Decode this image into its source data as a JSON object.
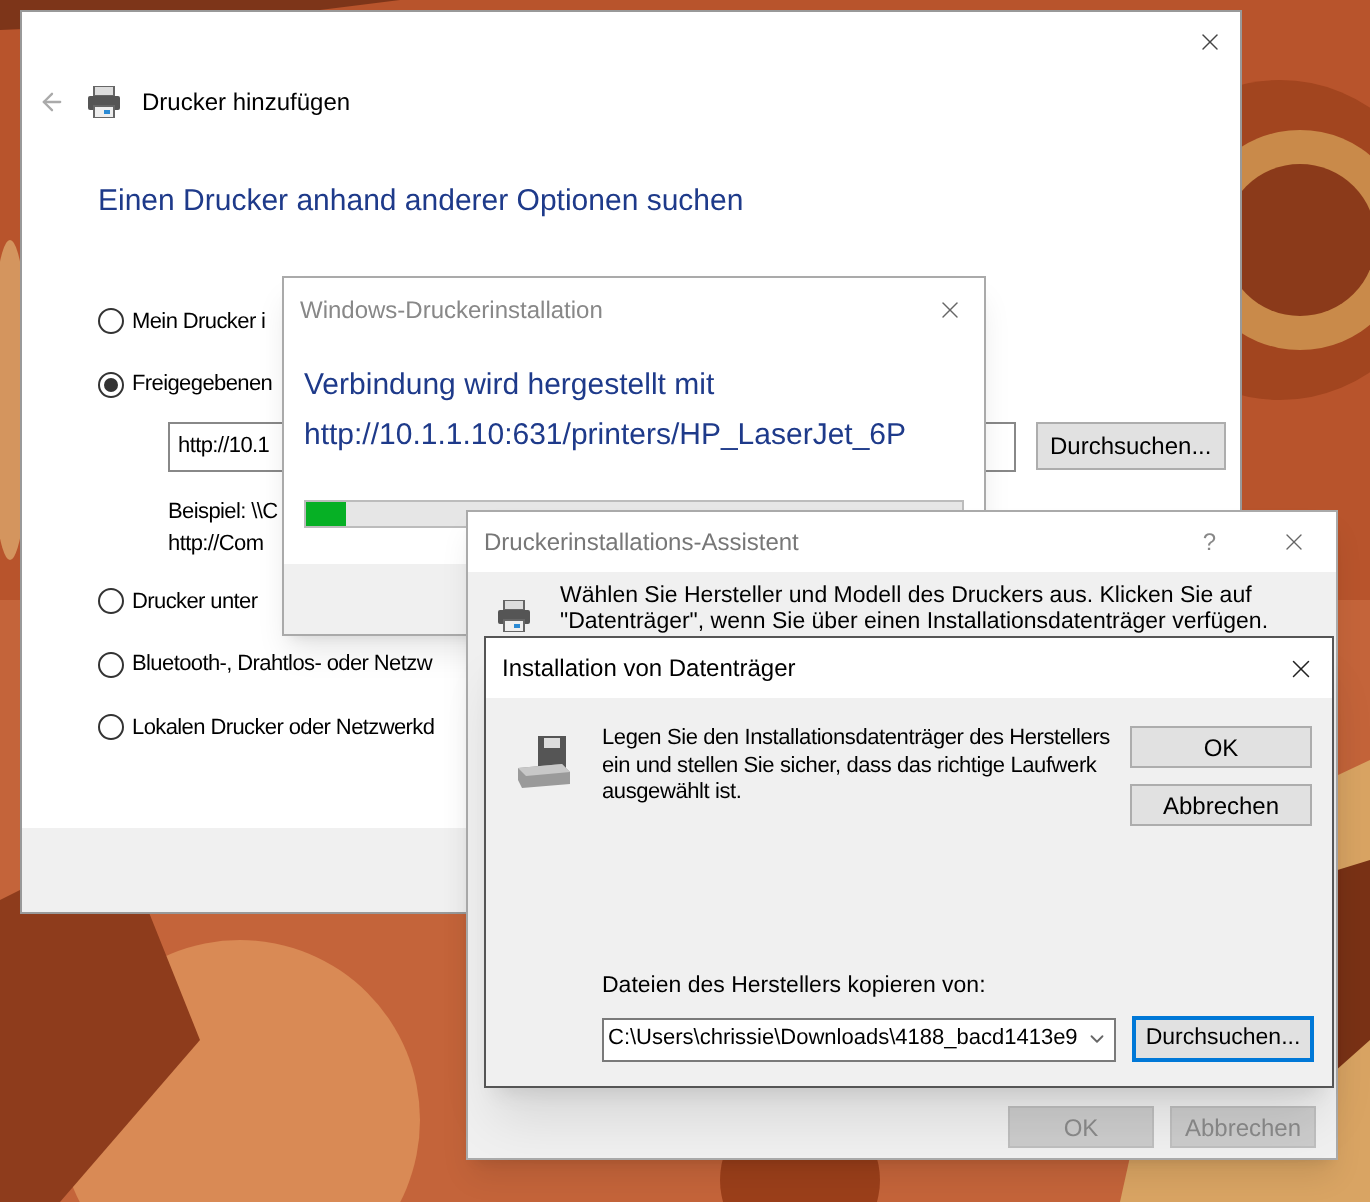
{
  "main_window": {
    "title": "Drucker hinzufügen",
    "heading": "Einen Drucker anhand anderer Optionen suchen",
    "options": [
      {
        "label": "Mein Drucker i",
        "selected": false
      },
      {
        "label": "Freigegebenen",
        "selected": true
      },
      {
        "label": "Drucker unter",
        "selected": false
      },
      {
        "label": "Bluetooth-, Drahtlos- oder Netzw",
        "selected": false
      },
      {
        "label": "Lokalen Drucker oder Netzwerkd",
        "selected": false
      }
    ],
    "address_field": {
      "value": "http://10.1"
    },
    "example_lines": [
      "Beispiel: \\\\C",
      "http://Com"
    ],
    "browse_button": "Durchsuchen..."
  },
  "progress_dialog": {
    "title": "Windows-Druckerinstallation",
    "message_lines": [
      "Verbindung wird hergestellt mit",
      "http://10.1.1.10:631/printers/HP_LaserJet_6P"
    ],
    "progress": {
      "level": 0.06
    }
  },
  "wizard": {
    "title": "Druckerinstallations-Assistent",
    "help": "?",
    "instructions": "Wählen Sie Hersteller und Modell des Druckers aus. Klicken Sie auf \"Datenträger\", wenn Sie über einen Installationsdatenträger verfügen.",
    "buttons": [
      {
        "label": "OK",
        "disabled": true
      },
      {
        "label": "Abbrechen",
        "disabled": true
      }
    ]
  },
  "disk_dialog": {
    "title": "Installation von Datenträger",
    "message": "Legen Sie den Installationsdatenträger des Herstellers ein und stellen Sie sicher, dass das richtige Laufwerk ausgewählt ist.",
    "buttons": [
      "OK",
      "Abbrechen"
    ],
    "copy_from_label": "Dateien des Herstellers kopieren von:",
    "path_field": {
      "value": "C:\\Users\\chrissie\\Downloads\\4188_bacd1413e9"
    },
    "browse_button": "Durchsuchen..."
  }
}
